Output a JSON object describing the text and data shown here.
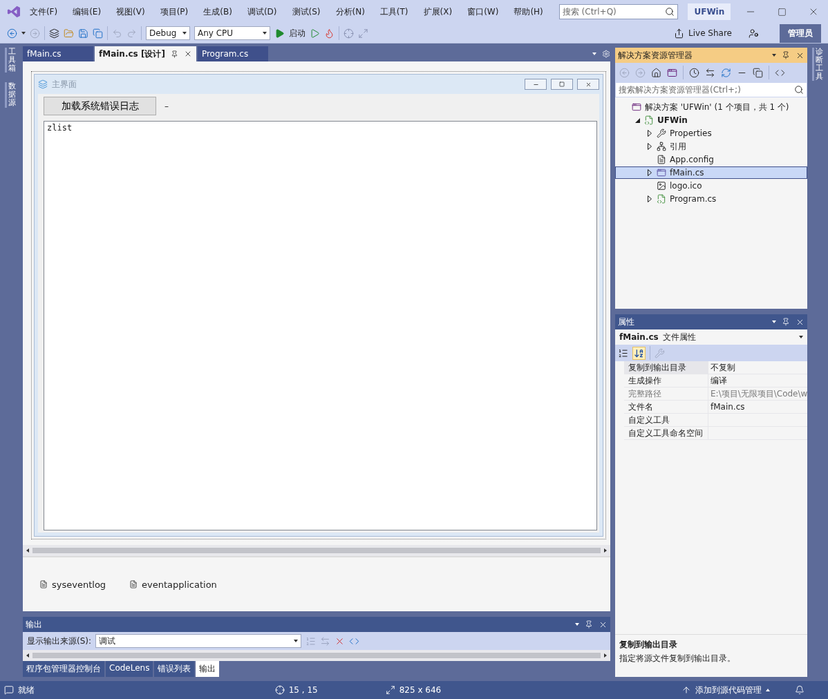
{
  "menu": [
    "文件(F)",
    "编辑(E)",
    "视图(V)",
    "项目(P)",
    "生成(B)",
    "调试(D)",
    "测试(S)",
    "分析(N)",
    "工具(T)",
    "扩展(X)",
    "窗口(W)",
    "帮助(H)"
  ],
  "search": {
    "placeholder": "搜索 (Ctrl+Q)"
  },
  "solution_badge": "UFWin",
  "toolbar": {
    "configuration": "Debug",
    "platform": "Any CPU",
    "start": "启动",
    "live_share": "Live Share",
    "user": "管理员"
  },
  "left_rail": [
    "工具箱",
    "数据源"
  ],
  "right_rail": [
    "诊断工具"
  ],
  "editor_tabs": [
    {
      "label": "fMain.cs",
      "selected": false
    },
    {
      "label": "fMain.cs [设计]",
      "selected": true
    },
    {
      "label": "Program.cs",
      "selected": false
    }
  ],
  "designer": {
    "form_title": "主界面",
    "button": "加载系统错误日志",
    "label": "–",
    "list_text": "zlist",
    "components": [
      "syseventlog",
      "eventapplication"
    ]
  },
  "solution_explorer": {
    "title": "解决方案资源管理器",
    "search": {
      "placeholder": "搜索解决方案资源管理器(Ctrl+;)"
    },
    "tree": [
      {
        "label": "解决方案 'UFWin' (1 个项目，共 1 个)",
        "kind": "solution",
        "selected": false,
        "children": [
          {
            "label": "UFWin",
            "kind": "project",
            "expandable": true,
            "expanded": true,
            "selected": false,
            "children": [
              {
                "label": "Properties",
                "kind": "wrench",
                "expandable": true,
                "expanded": false,
                "selected": false
              },
              {
                "label": "引用",
                "kind": "references",
                "expandable": true,
                "expanded": false,
                "selected": false
              },
              {
                "label": "App.config",
                "kind": "config",
                "expandable": false,
                "selected": false
              },
              {
                "label": "fMain.cs",
                "kind": "form",
                "expandable": true,
                "expanded": false,
                "selected": true
              },
              {
                "label": "logo.ico",
                "kind": "image",
                "expandable": false,
                "selected": false
              },
              {
                "label": "Program.cs",
                "kind": "csharp",
                "expandable": true,
                "expanded": false,
                "selected": false
              }
            ]
          }
        ]
      }
    ]
  },
  "properties": {
    "title": "属性",
    "object": "fMain.cs",
    "object_type": "文件属性",
    "rows": [
      {
        "name": "复制到输出目录",
        "value": "不复制",
        "selected": true,
        "disabled": false
      },
      {
        "name": "生成操作",
        "value": "编译",
        "selected": false,
        "disabled": false
      },
      {
        "name": "完整路径",
        "value": "E:\\项目\\无限项目\\Code\\w",
        "selected": false,
        "disabled": true
      },
      {
        "name": "文件名",
        "value": "fMain.cs",
        "selected": false,
        "disabled": false
      },
      {
        "name": "自定义工具",
        "selected": false,
        "disabled": false
      },
      {
        "name": "自定义工具命名空间",
        "selected": false,
        "disabled": false
      }
    ],
    "description_title": "复制到输出目录",
    "description": "指定将源文件复制到输出目录。"
  },
  "output": {
    "title": "输出",
    "source_label": "显示输出来源(S):",
    "source": "调试"
  },
  "bottom_tabs": [
    {
      "label": "程序包管理器控制台",
      "selected": false
    },
    {
      "label": "CodeLens",
      "selected": false
    },
    {
      "label": "错误列表",
      "selected": false
    },
    {
      "label": "输出",
      "selected": true
    }
  ],
  "status_bar": {
    "state": "就绪",
    "position": "15 , 15",
    "size": "825 x 646",
    "source_control": "添加到源代码管理"
  }
}
